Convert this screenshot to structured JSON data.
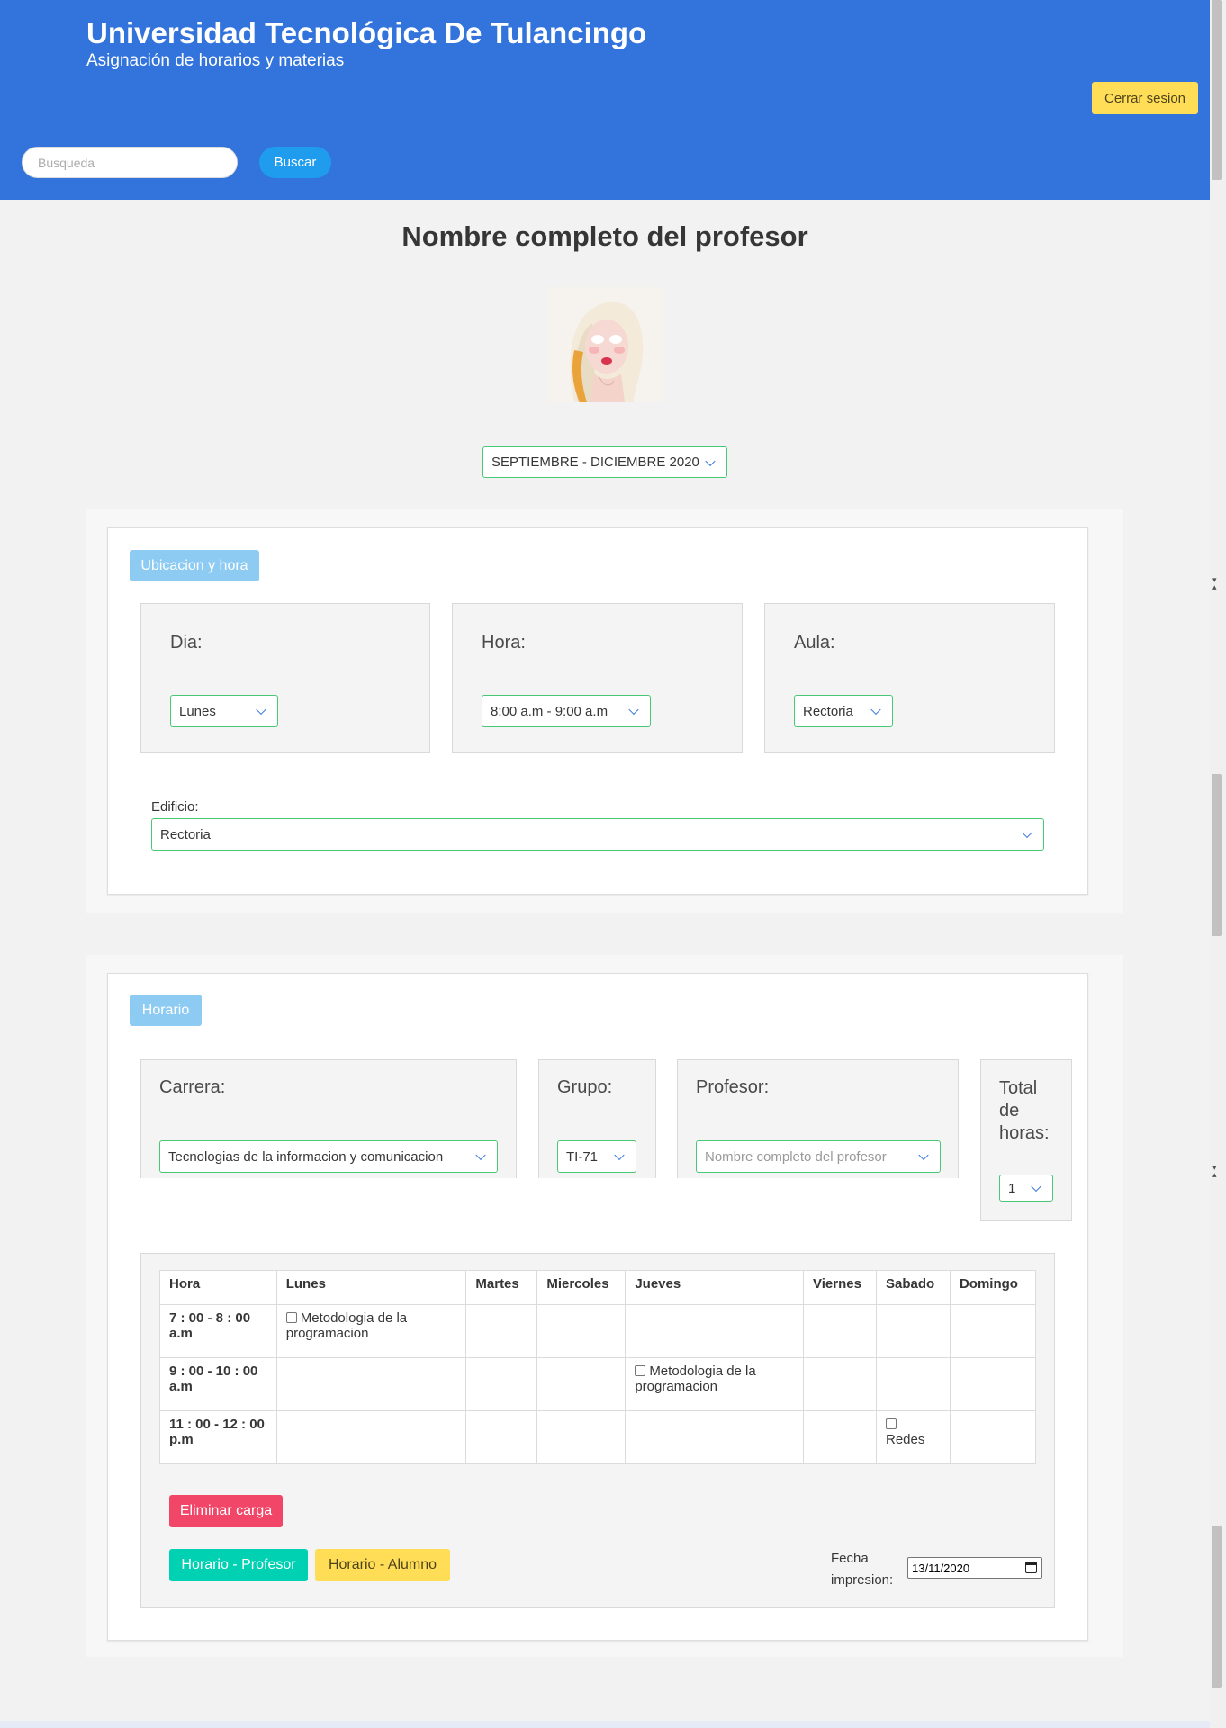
{
  "header": {
    "title": "Universidad Tecnológica De Tulancingo",
    "subtitle": "Asignación de horarios y materias",
    "logout_label": "Cerrar sesion",
    "search_placeholder": "Busqueda",
    "search_button": "Buscar"
  },
  "profile": {
    "name": "Nombre completo del profesor",
    "period": "SEPTIEMBRE - DICIEMBRE 2020"
  },
  "location": {
    "tag": "Ubicacion y hora",
    "day_label": "Dia:",
    "day_value": "Lunes",
    "hour_label": "Hora:",
    "hour_value": "8:00 a.m - 9:00 a.m",
    "room_label": "Aula:",
    "room_value": "Rectoria",
    "building_label": "Edificio:",
    "building_value": "Rectoria"
  },
  "schedule": {
    "tag": "Horario",
    "career_label": "Carrera:",
    "career_value": "Tecnologias de la informacion y comunicacion",
    "group_label": "Grupo:",
    "group_value": "TI-71",
    "teacher_label": "Profesor:",
    "teacher_placeholder": "Nombre completo del profesor",
    "hours_label": "Total de horas:",
    "hours_value": "1",
    "table": {
      "headers": [
        "Hora",
        "Lunes",
        "Martes",
        "Miercoles",
        "Jueves",
        "Viernes",
        "Sabado",
        "Domingo"
      ],
      "rows": [
        {
          "hour": "7 : 00 - 8 : 00 a.m",
          "cells": [
            "Metodologia de la programacion",
            "",
            "",
            "",
            "",
            "",
            ""
          ]
        },
        {
          "hour": "9 : 00 - 10 : 00 a.m",
          "cells": [
            "",
            "",
            "",
            "Metodologia de la programacion",
            "",
            "",
            ""
          ]
        },
        {
          "hour": "11 : 00 - 12 : 00 p.m",
          "cells": [
            "",
            "",
            "",
            "",
            "",
            "Redes",
            ""
          ]
        }
      ]
    },
    "delete_button": "Eliminar carga",
    "teacher_schedule_button": "Horario - Profesor",
    "student_schedule_button": "Horario - Alumno",
    "print_date_label": "Fecha impresion:",
    "print_date_value": "13/11/2020"
  },
  "colors": {
    "primary": "#3273dc",
    "info": "#209cee",
    "success": "#48c774",
    "warning": "#ffdd57",
    "danger": "#f14668",
    "turquoise": "#00d1b2"
  }
}
